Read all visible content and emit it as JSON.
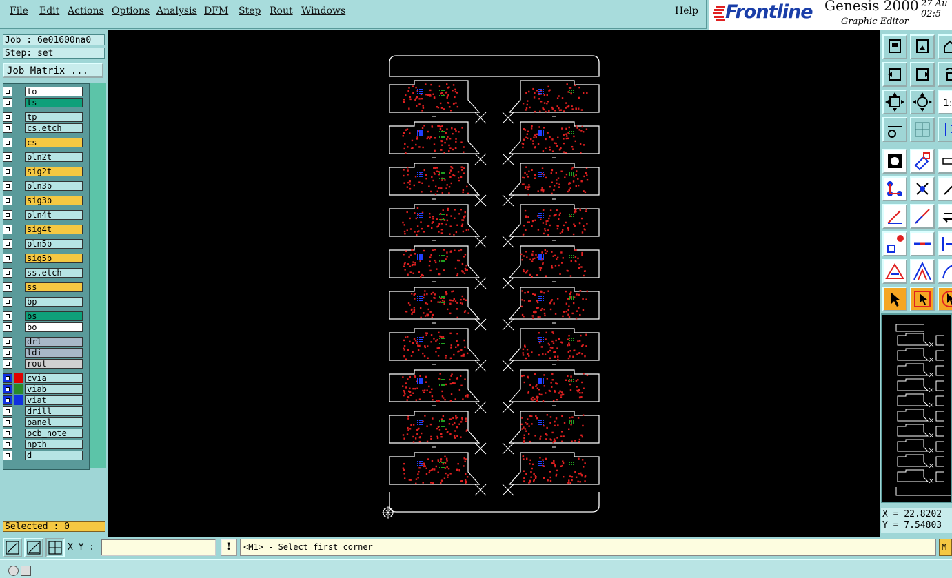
{
  "menubar": {
    "items": [
      "File",
      "Edit",
      "Actions",
      "Options",
      "Analysis",
      "DFM",
      "Step",
      "Rout",
      "Windows"
    ],
    "help": "Help"
  },
  "brand": {
    "logo": "Frontline",
    "product": "Genesis 2000",
    "subtitle": "Graphic Editor",
    "date_line1": "27 Au",
    "date_line2": "02:5"
  },
  "job": {
    "job_label": "Job : 6e01600na0",
    "step_label": "Step: set",
    "matrix_button": "Job Matrix ..."
  },
  "layers": [
    {
      "name": "to",
      "color": "#ffffff"
    },
    {
      "name": "ts",
      "color": "#0ea07a"
    },
    {
      "name": "tp",
      "color": "#b6e4e4"
    },
    {
      "name": "cs.etch",
      "color": "#b6e4e4"
    },
    {
      "name": "cs",
      "color": "#f5c842"
    },
    {
      "name": "pln2t",
      "color": "#b6e4e4"
    },
    {
      "name": "sig2t",
      "color": "#f5c842"
    },
    {
      "name": "pln3b",
      "color": "#b6e4e4"
    },
    {
      "name": "sig3b",
      "color": "#f5c842"
    },
    {
      "name": "pln4t",
      "color": "#b6e4e4"
    },
    {
      "name": "sig4t",
      "color": "#f5c842"
    },
    {
      "name": "pln5b",
      "color": "#b6e4e4"
    },
    {
      "name": "sig5b",
      "color": "#f5c842"
    },
    {
      "name": "ss.etch",
      "color": "#b6e4e4"
    },
    {
      "name": "ss",
      "color": "#f5c842"
    },
    {
      "name": "bp",
      "color": "#b6e4e4"
    },
    {
      "name": "bs",
      "color": "#0ea07a"
    },
    {
      "name": "bo",
      "color": "#ffffff"
    },
    {
      "name": "drl",
      "color": "#a8b8c8"
    },
    {
      "name": "ldi",
      "color": "#a8b8c8"
    },
    {
      "name": "rout",
      "color": "#d0d0d0"
    },
    {
      "name": "cvia",
      "color": "#b6e4e4",
      "swatch": "#e00000",
      "active": true
    },
    {
      "name": "viab",
      "color": "#b6e4e4",
      "swatch": "#2a8a2a",
      "active": true
    },
    {
      "name": "viat",
      "color": "#b6e4e4",
      "swatch": "#1030e0",
      "active": true
    },
    {
      "name": "drill",
      "color": "#b6e4e4"
    },
    {
      "name": "panel",
      "color": "#b6e4e4"
    },
    {
      "name": "pcb_note",
      "color": "#b6e4e4"
    },
    {
      "name": "npth",
      "color": "#b6e4e4"
    },
    {
      "name": "d",
      "color": "#b6e4e4"
    }
  ],
  "status": {
    "selected": "Selected : 0",
    "x": "X = 22.8202",
    "y": "Y = 7.54803"
  },
  "bottom": {
    "xy_label": "X Y :",
    "xy_value": "",
    "warn": "!",
    "prompt": "<M1> - Select first corner",
    "mode": "M"
  },
  "panel_layout": {
    "rows": 10,
    "columns": 2
  },
  "colors": {
    "canvas": "#000000",
    "outline": "#ffffff",
    "pad_red": "#e02020",
    "pad_blue": "#2040ff",
    "pad_green": "#20a020"
  },
  "toolbar_icons": [
    "save-job-icon",
    "close-job-icon",
    "home-icon",
    "zoom-home-icon",
    "zoom-back-icon",
    "zoom-prev-icon",
    "fit-screen-icon",
    "zoom-fit-icon",
    "one-to-one-icon",
    "measure-tools-icon",
    "grid-icon",
    "rout-icon",
    "pad-add-icon",
    "shape-edit-icon",
    "ruler-icon",
    "net-connect-icon",
    "cross-snap-icon",
    "pin-icon",
    "line-add-icon",
    "line-draw-icon",
    "arrow-move-icon",
    "feature-attrib-icon",
    "cut-line-icon",
    "split-icon",
    "angle-icon",
    "polygon-icon",
    "arc-icon",
    "select-pointer-icon",
    "select-box-icon",
    "rotate-select-icon"
  ]
}
